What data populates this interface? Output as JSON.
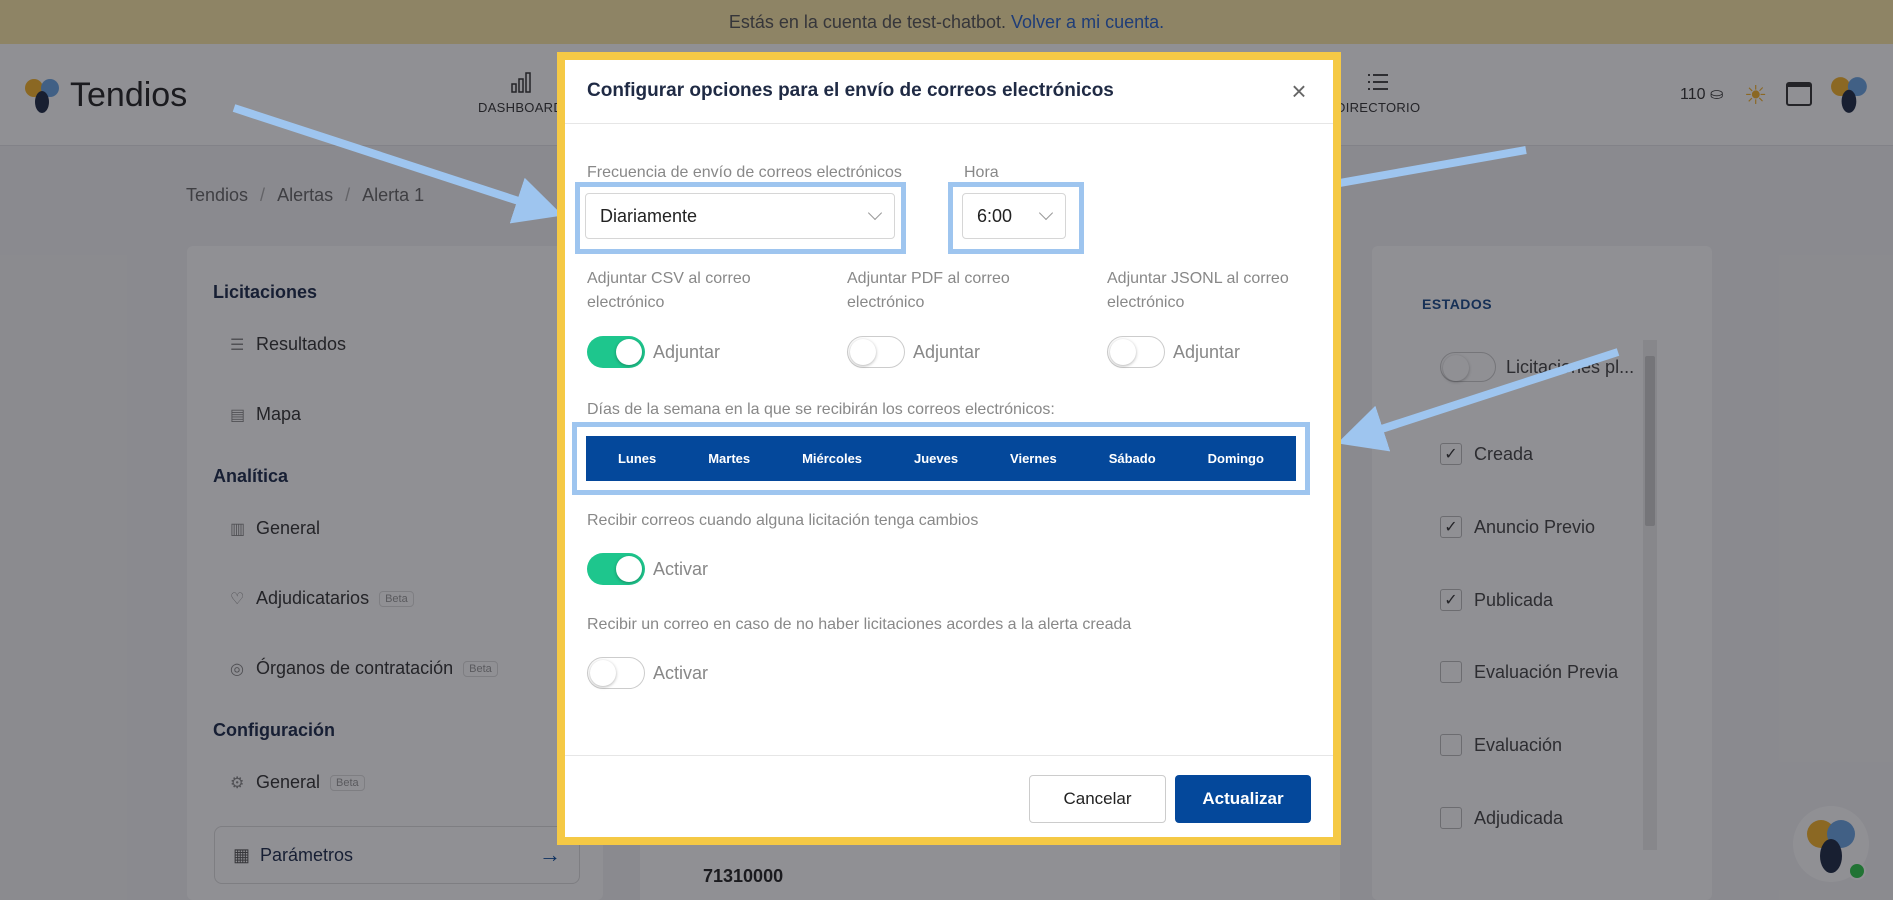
{
  "banner": {
    "text": "Estás en la cuenta de test-chatbot.",
    "link": "Volver a mi cuenta."
  },
  "app": {
    "name": "Tendios",
    "credits": "110"
  },
  "nav": {
    "dashboard": "DASHBOARD",
    "directorio": "DIRECTORIO"
  },
  "breadcrumb": [
    "Tendios",
    "Alertas",
    "Alerta 1"
  ],
  "sidebar": {
    "sections": [
      "Licitaciones",
      "Analítica",
      "Configuración"
    ],
    "items": [
      {
        "label": "Resultados",
        "icon": "list-icon"
      },
      {
        "label": "Mapa",
        "icon": "map-icon"
      },
      {
        "label": "General",
        "icon": "bar-chart-icon"
      },
      {
        "label": "Adjudicatarios",
        "icon": "handshake-icon",
        "badge": "Beta"
      },
      {
        "label": "Órganos de contratación",
        "icon": "org-icon",
        "badge": "Beta"
      },
      {
        "label": "General",
        "icon": "gear-icon",
        "badge": "Beta"
      },
      {
        "label": "Parámetros",
        "icon": "document-icon"
      }
    ]
  },
  "center": {
    "code": "71310000"
  },
  "filters": {
    "title": "ESTADOS",
    "items": [
      {
        "label": "Licitaciones pl...",
        "checked": false
      },
      {
        "label": "Creada",
        "checked": true
      },
      {
        "label": "Anuncio Previo",
        "checked": true
      },
      {
        "label": "Publicada",
        "checked": true
      },
      {
        "label": "Evaluación Previa",
        "checked": false
      },
      {
        "label": "Evaluación",
        "checked": false
      },
      {
        "label": "Adjudicada",
        "checked": false
      }
    ]
  },
  "modal": {
    "title": "Configurar opciones para el envío de correos electrónicos",
    "frequency": {
      "label": "Frecuencia de envío de correos electrónicos",
      "value": "Diariamente"
    },
    "hour": {
      "label": "Hora",
      "value": "6:00"
    },
    "attachments": [
      {
        "label": "Adjuntar CSV al correo electrónico",
        "toggle": "Adjuntar",
        "on": true
      },
      {
        "label": "Adjuntar PDF al correo electrónico",
        "toggle": "Adjuntar",
        "on": false
      },
      {
        "label": "Adjuntar JSONL al correo electrónico",
        "toggle": "Adjuntar",
        "on": false
      }
    ],
    "days_label": "Días de la semana en la que se recibirán los correos electrónicos:",
    "days": [
      "Lunes",
      "Martes",
      "Miércoles",
      "Jueves",
      "Viernes",
      "Sábado",
      "Domingo"
    ],
    "changes": {
      "label": "Recibir correos cuando alguna licitación tenga cambios",
      "toggle": "Activar",
      "on": true
    },
    "no_results": {
      "label": "Recibir un correo en caso de no haber licitaciones acordes a la alerta creada",
      "toggle": "Activar",
      "on": false
    },
    "cancel": "Cancelar",
    "update": "Actualizar"
  },
  "colors": {
    "primary": "#04489b",
    "toggle_on": "#1ec68d",
    "highlight": "#9ec5ef",
    "frame": "#f5c945"
  }
}
